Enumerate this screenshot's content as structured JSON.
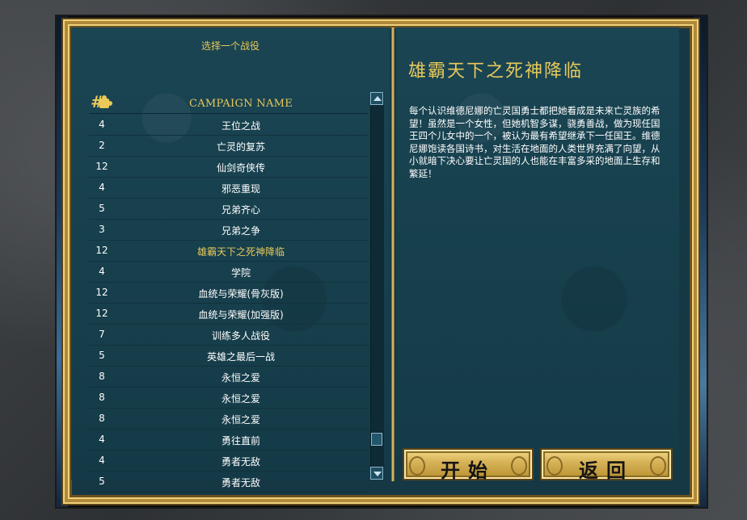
{
  "header": {
    "select_title": "选择一个战役",
    "column_header": "CAMPAIGN NAME"
  },
  "campaigns": [
    {
      "num": "4",
      "name": "王位之战"
    },
    {
      "num": "2",
      "name": "亡灵的复苏"
    },
    {
      "num": "12",
      "name": "仙剑奇侠传"
    },
    {
      "num": "4",
      "name": "邪恶重现"
    },
    {
      "num": "5",
      "name": "兄弟齐心"
    },
    {
      "num": "3",
      "name": "兄弟之争"
    },
    {
      "num": "12",
      "name": "雄霸天下之死神降临"
    },
    {
      "num": "4",
      "name": "学院"
    },
    {
      "num": "12",
      "name": "血统与荣耀(骨灰版)"
    },
    {
      "num": "12",
      "name": "血统与荣耀(加强版)"
    },
    {
      "num": "7",
      "name": "训练多人战役"
    },
    {
      "num": "5",
      "name": "英雄之最后一战"
    },
    {
      "num": "8",
      "name": "永恒之爱"
    },
    {
      "num": "8",
      "name": "永恒之爱"
    },
    {
      "num": "8",
      "name": "永恒之爱"
    },
    {
      "num": "4",
      "name": "勇往直前"
    },
    {
      "num": "4",
      "name": "勇者无敌"
    },
    {
      "num": "5",
      "name": "勇者无敌"
    }
  ],
  "selected_index": 6,
  "detail": {
    "title": "雄霸天下之死神降临",
    "description": "每个认识维德尼娜的亡灵国勇士都把她看成是未来亡灵族的希望！虽然是一个女性，但她机智多谋，骁勇善战，做为现任国王四个儿女中的一个，被认为最有希望继承下一任国王。维德尼娜饱读各国诗书，对生活在地面的人类世界充满了向望，从小就暗下决心要让亡灵国的人也能在丰富多采的地面上生存和繁延！"
  },
  "buttons": {
    "start": "开始",
    "back": "返回"
  },
  "colors": {
    "accent_gold": "#e8c95a",
    "panel_teal": "#17404c",
    "text_white": "#ffffff"
  }
}
